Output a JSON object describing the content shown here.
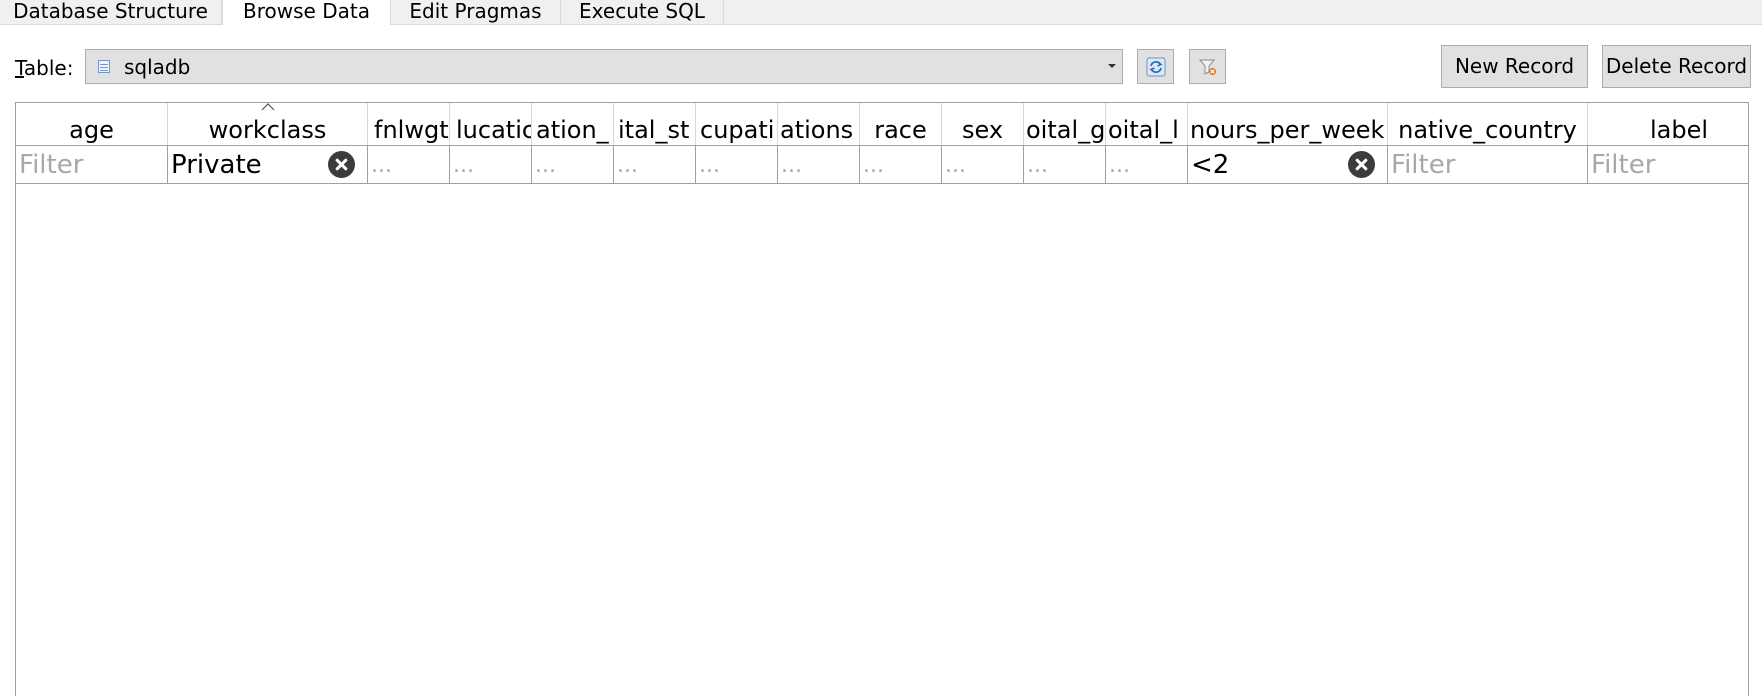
{
  "tabs": [
    {
      "label": "Database Structure",
      "active": false
    },
    {
      "label": "Browse Data",
      "active": true
    },
    {
      "label": "Edit Pragmas",
      "active": false
    },
    {
      "label": "Execute SQL",
      "active": false
    }
  ],
  "table_selector": {
    "label_accel": "T",
    "label_rest": "able:",
    "selected": "sqladb"
  },
  "toolbar": {
    "refresh_icon": "refresh-icon",
    "clear_filters_icon": "clear-filters-icon",
    "new_record": "New Record",
    "delete_record": "Delete Record"
  },
  "grid": {
    "columns": [
      {
        "visible_text": "age"
      },
      {
        "visible_text": "workclass",
        "sorted": true
      },
      {
        "visible_text": "fnlwgt"
      },
      {
        "visible_text": "lucatic"
      },
      {
        "visible_text": "ation_"
      },
      {
        "visible_text": "ital_st"
      },
      {
        "visible_text": "cupati"
      },
      {
        "visible_text": "ations"
      },
      {
        "visible_text": "race"
      },
      {
        "visible_text": "sex"
      },
      {
        "visible_text": "oital_g"
      },
      {
        "visible_text": "oital_l"
      },
      {
        "visible_text": "nours_per_week"
      },
      {
        "visible_text": "native_country"
      },
      {
        "visible_text": "label"
      }
    ],
    "filters": [
      {
        "placeholder": "Filter"
      },
      {
        "value": "Private"
      },
      {
        "placeholder": "..."
      },
      {
        "placeholder": "..."
      },
      {
        "placeholder": "..."
      },
      {
        "placeholder": "..."
      },
      {
        "placeholder": "..."
      },
      {
        "placeholder": "..."
      },
      {
        "placeholder": "..."
      },
      {
        "placeholder": "..."
      },
      {
        "placeholder": "..."
      },
      {
        "placeholder": "..."
      },
      {
        "value": "<2"
      },
      {
        "placeholder": "Filter"
      },
      {
        "placeholder": "Filter"
      }
    ]
  }
}
